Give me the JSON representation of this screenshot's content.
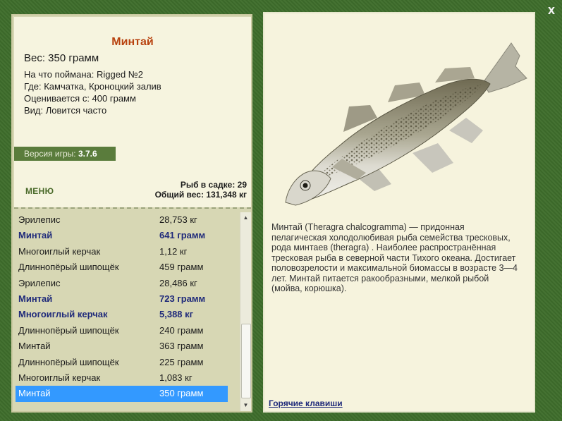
{
  "window": {
    "close_label": "x"
  },
  "fish": {
    "name": "Минтай",
    "weight_line": "Вес: 350 грамм",
    "caught_on": "На что поймана: Rigged №2",
    "location": "Где: Камчатка, Кроноцкий залив",
    "valued_from": "Оценивается с: 400 грамм",
    "frequency": "Вид: Ловится часто"
  },
  "version": {
    "label": "Версия игры:",
    "value": "3.7.6"
  },
  "menu_label": "МЕНЮ",
  "stats": {
    "fish_in_keepnet": "Рыб в садке: 29",
    "total_weight": "Общий вес: 131,348 кг"
  },
  "catch_list": [
    {
      "name": "Эрилепис",
      "weight": "28,753 кг",
      "bold": false,
      "selected": false
    },
    {
      "name": "Минтай",
      "weight": "641 грамм",
      "bold": true,
      "selected": false
    },
    {
      "name": "Многоиглый керчак",
      "weight": "1,12 кг",
      "bold": false,
      "selected": false
    },
    {
      "name": "Длиннопёрый шипощёк",
      "weight": "459 грамм",
      "bold": false,
      "selected": false
    },
    {
      "name": "Эрилепис",
      "weight": "28,486 кг",
      "bold": false,
      "selected": false
    },
    {
      "name": "Минтай",
      "weight": "723 грамм",
      "bold": true,
      "selected": false
    },
    {
      "name": "Многоиглый керчак",
      "weight": "5,388 кг",
      "bold": true,
      "selected": false
    },
    {
      "name": "Длиннопёрый шипощёк",
      "weight": "240 грамм",
      "bold": false,
      "selected": false
    },
    {
      "name": "Минтай",
      "weight": "363 грамм",
      "bold": false,
      "selected": false
    },
    {
      "name": "Длиннопёрый шипощёк",
      "weight": "225 грамм",
      "bold": false,
      "selected": false
    },
    {
      "name": "Многоиглый керчак",
      "weight": "1,083 кг",
      "bold": false,
      "selected": false
    },
    {
      "name": "Минтай",
      "weight": "350 грамм",
      "bold": false,
      "selected": true
    }
  ],
  "description": "Минтай (Theragra chalcogramma) — придонная пелагическая холодолюбивая рыба семейства тресковых, рода минтаев (theragra) . Наиболее распространённая тресковая рыба в северной части Тихого океана. Достигает половозрелости и максимальной биомассы в возрасте 3—4 лет. Минтай питается ракообразными, мелкой рыбой (мойва, корюшка).",
  "hotkeys_label": "Горячие клавиши",
  "colors": {
    "frame": "#3f6e2c",
    "panel": "#f6f4df",
    "title": "#b8420f",
    "highlight_text": "#1f2a7a",
    "selection": "#3399ff"
  },
  "icons": [
    "close-icon",
    "scroll-up-icon",
    "scroll-down-icon",
    "fish-illustration"
  ]
}
